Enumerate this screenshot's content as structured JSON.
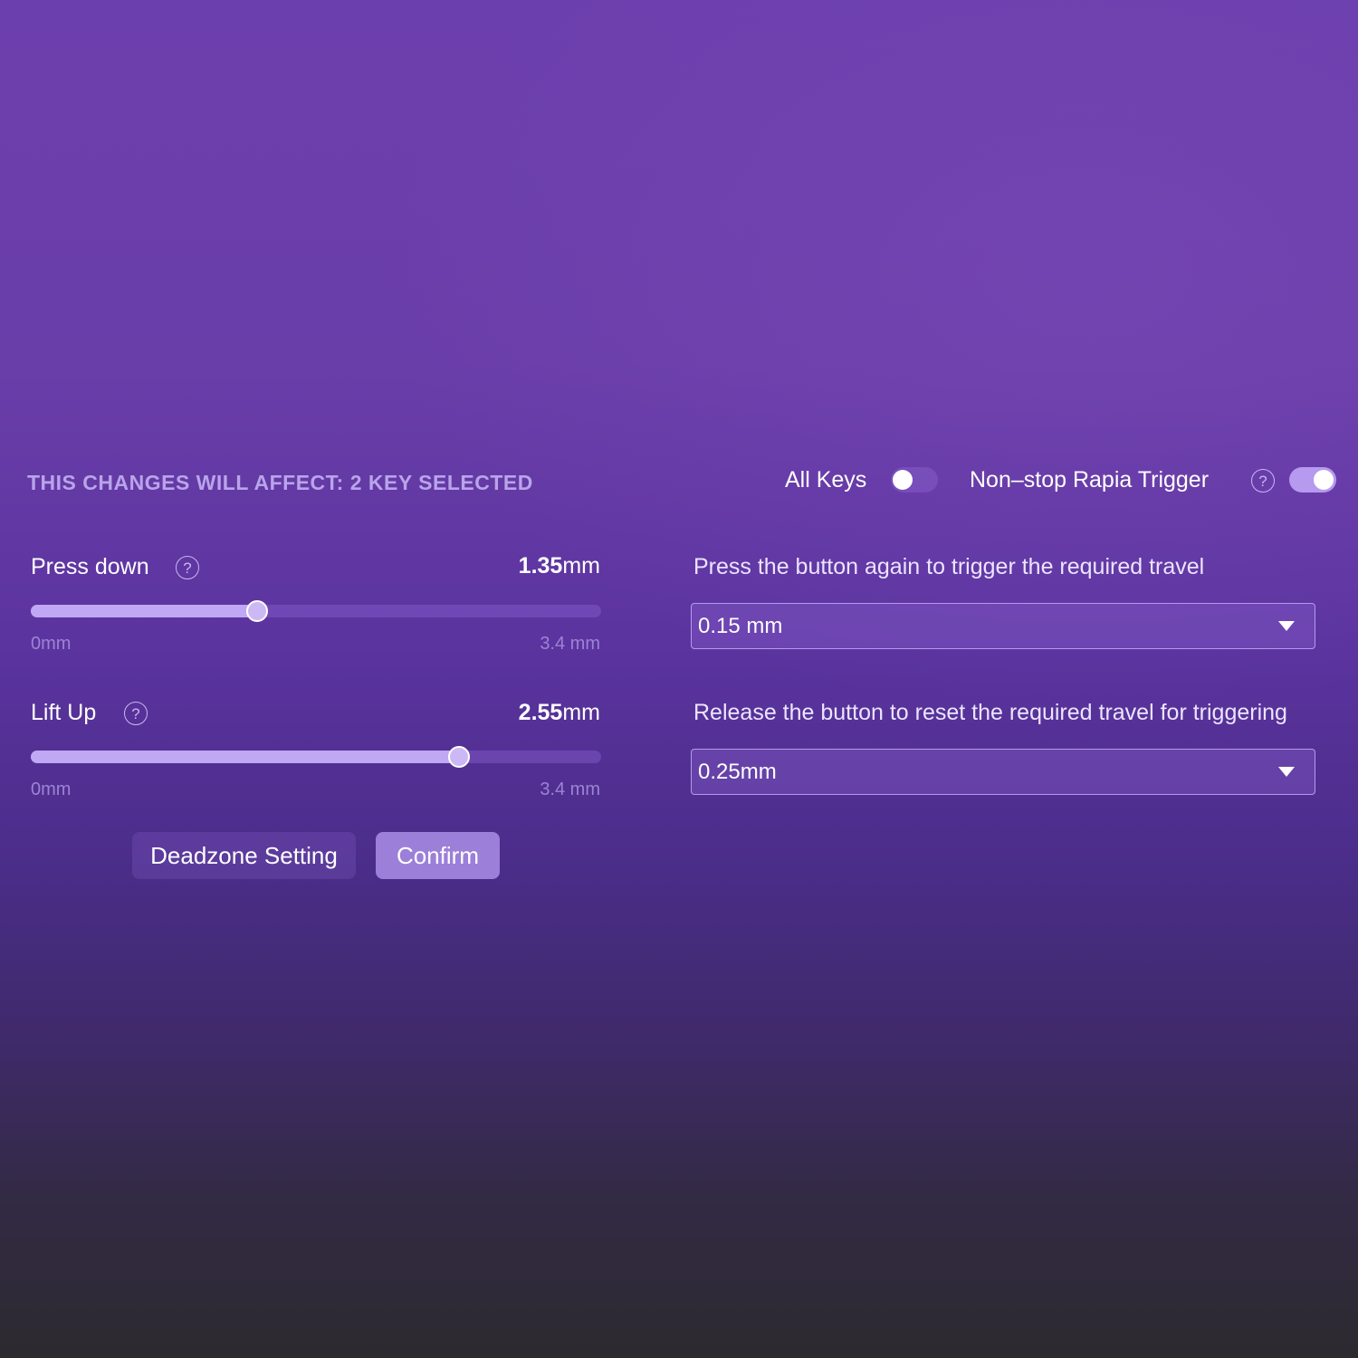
{
  "header": {
    "affect_text": "THIS CHANGES WILL AFFECT: 2 KEY SELECTED"
  },
  "toggles": {
    "all_keys": {
      "label": "All Keys",
      "on": false
    },
    "nonstop": {
      "label": "Non–stop Rapia Trigger",
      "on": true
    }
  },
  "press_down": {
    "label": "Press down",
    "value_number": "1.35",
    "value_unit": "mm",
    "min_label": "0mm",
    "max_label": "3.4 mm",
    "value": 1.35,
    "max": 3.4
  },
  "lift_up": {
    "label": "Lift Up",
    "value_number": "2.55",
    "value_unit": "mm",
    "min_label": "0mm",
    "max_label": "3.4 mm",
    "value": 2.55,
    "max": 3.4
  },
  "buttons": {
    "deadzone": "Deadzone Setting",
    "confirm": "Confirm"
  },
  "trigger_travel": {
    "description": "Press the button again to trigger the required travel",
    "selected": "0.15 mm"
  },
  "reset_travel": {
    "description": "Release the button to reset the required travel for triggering",
    "selected": "0.25mm"
  },
  "icons": {
    "help": "?"
  },
  "colors": {
    "accent": "#b59af0",
    "header_text": "#b9a4ea",
    "confirm_bg": "#9c7fd9"
  }
}
